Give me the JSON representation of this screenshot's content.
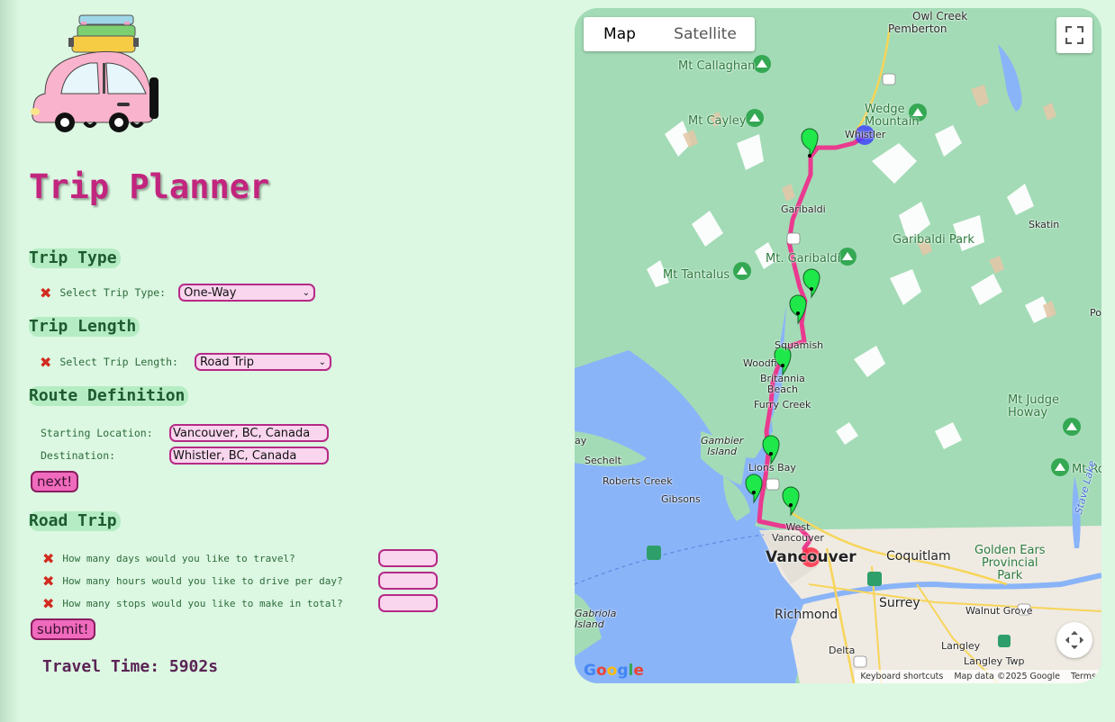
{
  "app": {
    "title": "Trip Planner",
    "accent_color": "#c2257e",
    "background_color": "#dcf8e2"
  },
  "logo": {
    "icon": "car-with-luggage-icon"
  },
  "trip_type": {
    "heading": "Trip Type",
    "label": "Select Trip Type:",
    "selected": "One-Way",
    "status_icon": "red-x-icon"
  },
  "trip_length": {
    "heading": "Trip Length",
    "label": "Select Trip Length:",
    "selected": "Road Trip",
    "status_icon": "red-x-icon"
  },
  "route": {
    "heading": "Route Definition",
    "start_label": "Starting Location:",
    "start_value": "Vancouver, BC, Canada",
    "dest_label": "Destination:",
    "dest_value": "Whistler, BC, Canada",
    "next_button": "next!"
  },
  "road_trip": {
    "heading": "Road Trip",
    "questions": [
      "How many days would you like to travel?",
      "How many hours would you like to drive per day?",
      "How many stops would you like to make in total?"
    ],
    "submit_button": "submit!"
  },
  "travel_time": "Travel Time: 5902s",
  "map": {
    "tabs": [
      "Map",
      "Satellite"
    ],
    "active_tab": "Map",
    "places": {
      "owl_creek": "Owl Creek",
      "pemberton": "Pemberton",
      "mt_callaghan": "Mt Callaghan",
      "wedge_mountain": "Wedge\nMountain",
      "mt_cayley": "Mt Cayley",
      "whistler": "Whistler",
      "garibaldi": "Garibaldi",
      "skatin": "Skatin",
      "garibaldi_park": "Garibaldi Park",
      "mt_garibaldi": "Mt. Garibaldi",
      "mt_tantalus": "Mt Tantalus",
      "squamish": "Squamish",
      "woodfibre": "Woodfi",
      "britannia_beach": "Britannia\nBeach",
      "furry_creek": "Furry Creek",
      "mt_judge_howay": "Mt Judge\nHoway",
      "gambier_island": "Gambier\nIsland",
      "sechelt": "Sechelt",
      "lions_bay": "Lions Bay",
      "mt_ro": "Mt Ro",
      "roberts_creek": "Roberts Creek",
      "gibsons": "Gibsons",
      "west_vancouver": "West\nVancouver",
      "vancouver": "Vancouver",
      "coquitlam": "Coquitlam",
      "golden_ears": "Golden Ears\nProvincial\nPark",
      "surrey": "Surrey",
      "richmond": "Richmond",
      "walnut_grove": "Walnut Grove",
      "gabriola_island": "Gabriola\nIsland",
      "delta": "Delta",
      "langley": "Langley",
      "langley_twp": "Langley Twp",
      "stave_lake": "Stave Lake",
      "edge_po": "Po",
      "edge_ay": "ay"
    },
    "highway_shields": [
      "99",
      "99",
      "99",
      "5",
      "1",
      "15",
      "1A",
      "10"
    ],
    "google_logo": "Google",
    "attribution": [
      "Keyboard shortcuts",
      "Map data ©2025 Google",
      "Terms"
    ],
    "marker_colors": {
      "stop": "#1ee84a",
      "start": "#ff2a44",
      "end": "#3b3bff",
      "route": "#ea3a8f"
    }
  }
}
